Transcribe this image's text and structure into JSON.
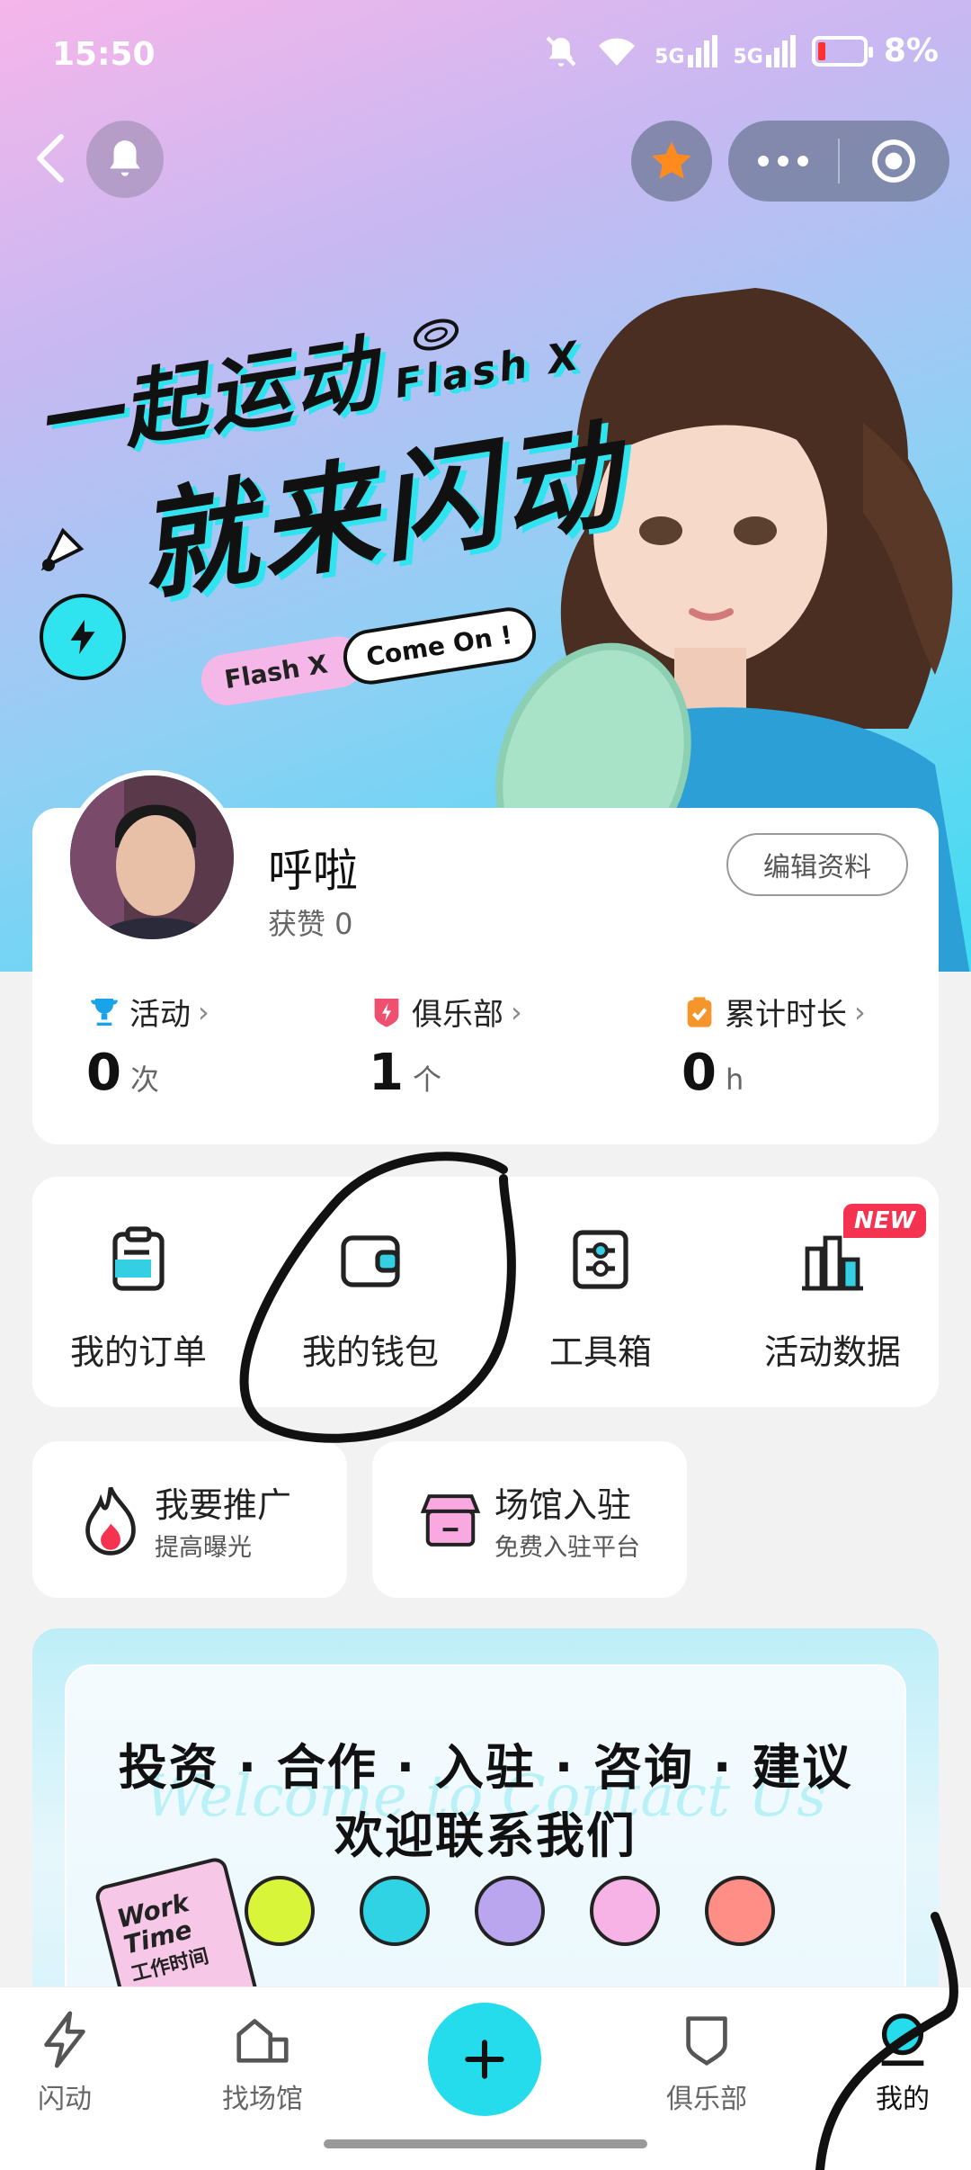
{
  "status_bar": {
    "time": "15:50",
    "network1": "5G",
    "network2": "5G",
    "battery": "8%"
  },
  "banner": {
    "slogan_line1": "一起运动",
    "slogan_brand": "Flash X",
    "slogan_line2": "就来闪动",
    "pill_brand": "Flash X",
    "pill_cta": "Come On !"
  },
  "profile": {
    "nickname": "呼啦",
    "likes": "获赞 0",
    "edit_button": "编辑资料",
    "stats": [
      {
        "label": "活动",
        "value": "0",
        "unit": "次"
      },
      {
        "label": "俱乐部",
        "value": "1",
        "unit": "个"
      },
      {
        "label": "累计时长",
        "value": "0",
        "unit": "h"
      }
    ]
  },
  "menu": {
    "items": [
      {
        "label": "我的订单"
      },
      {
        "label": "我的钱包"
      },
      {
        "label": "工具箱"
      },
      {
        "label": "活动数据"
      }
    ],
    "new_badge": "NEW"
  },
  "promos": [
    {
      "title": "我要推广",
      "subtitle": "提高曝光"
    },
    {
      "title": "场馆入驻",
      "subtitle": "免费入驻平台"
    }
  ],
  "contact": {
    "line1": "投资 · 合作 · 入驻 · 咨询 · 建议",
    "line2": "欢迎联系我们",
    "watermark": "Welcome to Contact Us",
    "tag_en": "Work Time",
    "tag_cn": "工作时间"
  },
  "tabbar": {
    "tabs": [
      {
        "label": "闪动"
      },
      {
        "label": "找场馆"
      },
      {
        "label": "俱乐部"
      },
      {
        "label": "我的"
      }
    ]
  },
  "colors": {
    "accent": "#25dcec",
    "new_badge": "#f5324f"
  }
}
